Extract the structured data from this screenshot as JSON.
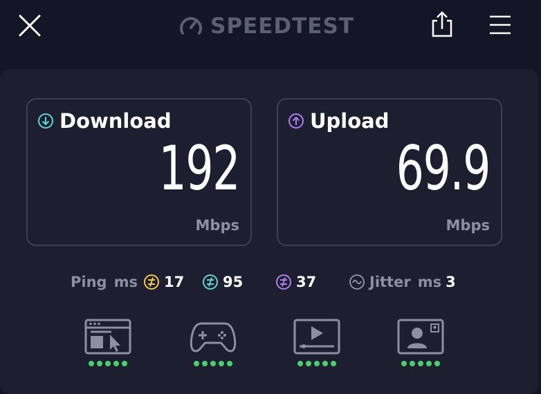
{
  "header": {
    "logo_text": "SPEEDTEST",
    "close_icon": "close-icon",
    "share_icon": "share-icon",
    "menu_icon": "menu-icon"
  },
  "download": {
    "label": "Download",
    "value": "192",
    "unit": "Mbps",
    "icon": "download-arrow-icon",
    "color": "#5fd6d2"
  },
  "upload": {
    "label": "Upload",
    "value": "69.9",
    "unit": "Mbps",
    "icon": "upload-arrow-icon",
    "color": "#b07ef0"
  },
  "ping": {
    "label": "Ping",
    "unit": "ms",
    "idle": {
      "value": "17",
      "color": "#f3c94f"
    },
    "download": {
      "value": "95",
      "color": "#5fd6d2"
    },
    "upload": {
      "value": "37",
      "color": "#b07ef0"
    }
  },
  "jitter": {
    "label": "Jitter",
    "unit": "ms",
    "value": "3"
  },
  "app_ratings": [
    {
      "icon": "web-browsing-icon",
      "rating": 5,
      "max": 5
    },
    {
      "icon": "gaming-icon",
      "rating": 5,
      "max": 5
    },
    {
      "icon": "video-streaming-icon",
      "rating": 5,
      "max": 5
    },
    {
      "icon": "video-chat-icon",
      "rating": 5,
      "max": 5
    }
  ],
  "colors": {
    "background": "#141526",
    "panel": "#1d1e30",
    "card_border": "#3c3f52",
    "muted_text": "#8d90a3",
    "rating_dot": "#4ece6e"
  }
}
